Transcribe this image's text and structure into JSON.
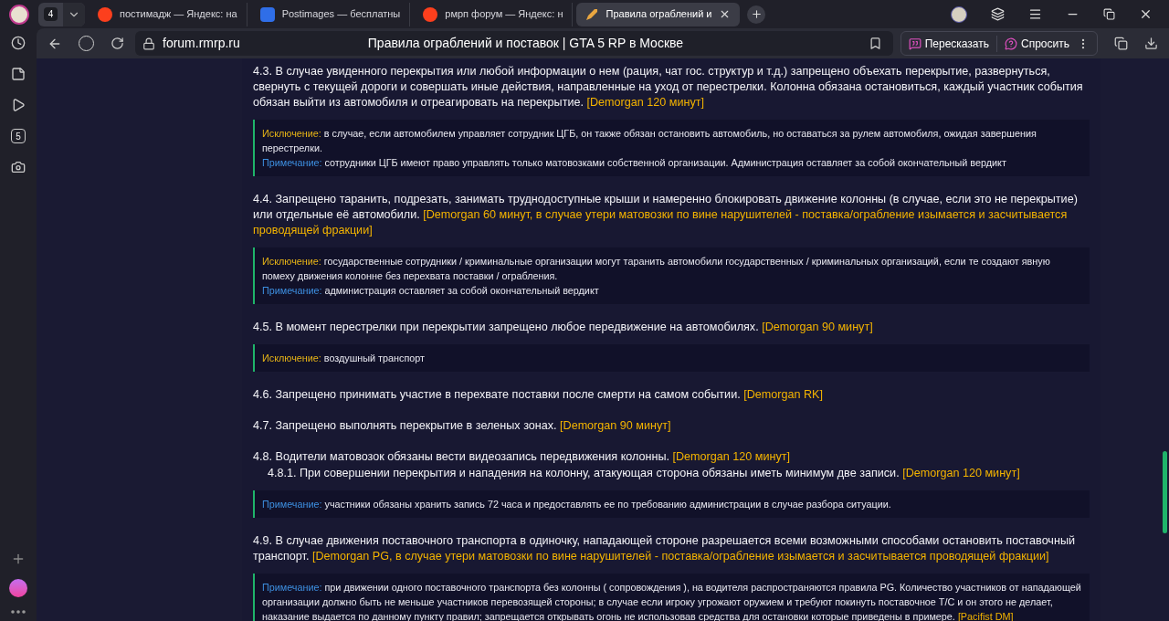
{
  "browser": {
    "tab_count": "4",
    "tabs": [
      {
        "title": "постимадж — Яндекс: на",
        "selected": false
      },
      {
        "title": "Postimages — бесплатны",
        "selected": false
      },
      {
        "title": "рмрп форум — Яндекс: н",
        "selected": false
      },
      {
        "title": "Правила ограблений и",
        "selected": true
      }
    ],
    "url": "forum.rmrp.ru",
    "page_title": "Правила ограблений и поставок | GTA 5 RP в Москве",
    "retell": "Пересказать",
    "ask": "Спросить",
    "sidebar_badge": "5"
  },
  "rules": [
    {
      "text": "4.3. В случае увиденного перекрытия или любой информации о нем (рация, чат гос. структур и т.д.) запрещено объехать перекрытие, развернуться, свернуть с текущей дороги и совершать иные действия, направленные на уход от перестрелки. Колонна обязана остановиться, каждый участник события обязан выйти из автомобиля и отреагировать на перекрытие.",
      "penalty": "[Demorgan 120 минут]",
      "notes": [
        {
          "kind": "exception",
          "label": "Исключение:",
          "text": "в случае, если автомобилем управляет сотрудник ЦГБ, он также обязан остановить автомобиль, но оставаться за рулем автомобиля, ожидая завершения перестрелки."
        },
        {
          "kind": "note",
          "label": "Примечание:",
          "text": "сотрудники ЦГБ имеют право управлять только матовозками собственной организации. Администрация оставляет за собой окончательный вердикт"
        }
      ]
    },
    {
      "text": "4.4. Запрещено таранить, подрезать, занимать труднодоступные крыши и намеренно блокировать движение колонны (в случае, если это не перекрытие) или отдельные её автомобили.",
      "penalty": "[Demorgan 60 минут, в случае утери матовозки по вине нарушителей - поставка/ограбление изымается и засчитывается проводящей фракции]",
      "notes": [
        {
          "kind": "exception",
          "label": "Исключение:",
          "text": "государственные сотрудники / криминальные организации могут таранить автомобили государственных / криминальных организаций, если те создают явную помеху движения колонне без перехвата поставки / ограбления."
        },
        {
          "kind": "note",
          "label": "Примечание:",
          "text": "администрация оставляет за собой окончательный вердикт"
        }
      ]
    },
    {
      "text": "4.5. В момент перестрелки при перекрытии запрещено любое передвижение на автомобилях.",
      "penalty": "[Demorgan 90 минут]",
      "notes": [
        {
          "kind": "exception",
          "label": "Исключение:",
          "text": "воздушный транспорт"
        }
      ]
    },
    {
      "text": "4.6. Запрещено принимать участие в перехвате поставки после смерти на самом событии.",
      "penalty": "[Demorgan RK]"
    },
    {
      "text": "4.7. Запрещено выполнять перекрытие в зеленых зонах.",
      "penalty": "[Demorgan 90 минут]"
    },
    {
      "text": "4.8. Водители матовозок обязаны вести видеозапись передвижения колонны.",
      "penalty": "[Demorgan 120 минут]",
      "children": [
        {
          "text": "4.8.1. При совершении перекрытия и нападения на колонну, атакующая сторона обязаны иметь минимум две записи.",
          "penalty": "[Demorgan 120 минут]"
        }
      ],
      "notes": [
        {
          "kind": "note",
          "label": "Примечание:",
          "text": "участники обязаны хранить запись 72 часа и предоставлять ее по требованию администрации в случае разбора ситуации."
        }
      ]
    },
    {
      "text": "4.9. В случае движения поставочного транспорта в одиночку, нападающей стороне разрешается всеми возможными способами остановить поставочный транспорт.",
      "penalty": "[Demorgan PG, в случае утери матовозки по вине нарушителей - поставка/ограбление изымается и засчитывается проводящей фракции]",
      "notes": [
        {
          "kind": "note",
          "label": "Примечание:",
          "text": "при движении одного поставочного транспорта без колонны ( сопровождения ), на водителя распространяются правила PG. Количество участников от нападающей организации должно быть не меньше участников перевозящей стороны; в случае если игроку угрожают оружием и требуют покинуть поставочное Т/С и он этого не делает, наказание выдается по данному пункту правил; запрещается открывать огонь не использовав средства для остановки которые приведены в примере.",
          "penalty": "[Pacifist DM]"
        }
      ]
    }
  ]
}
